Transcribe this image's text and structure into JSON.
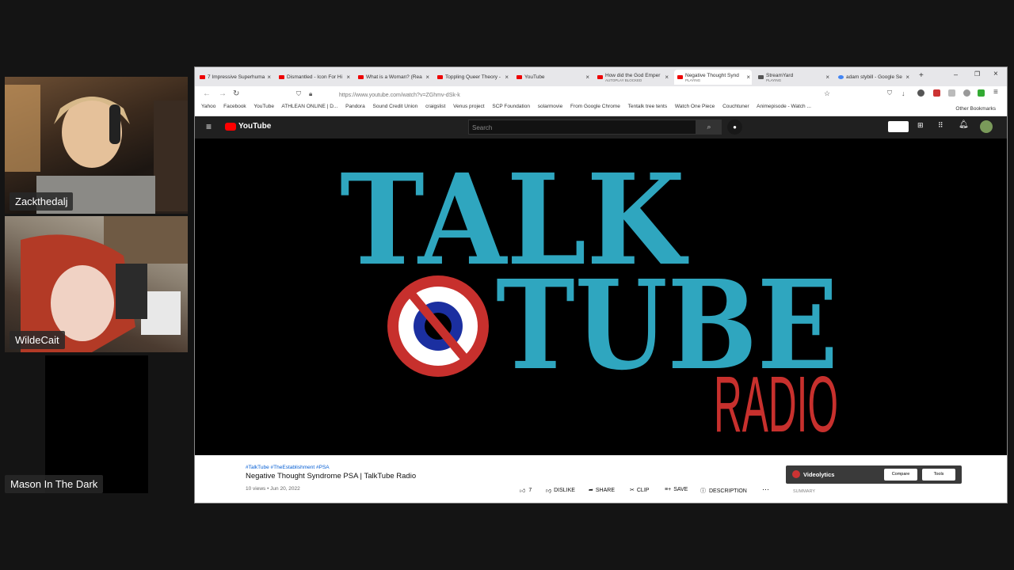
{
  "participants": [
    {
      "name": "Zackthedalj"
    },
    {
      "name": "WildeCait"
    },
    {
      "name": "Mason In The Dark"
    }
  ],
  "browser": {
    "tabs": [
      {
        "label": "7 Impressive Superhuma"
      },
      {
        "label": "Dismantled - Icon For Hi"
      },
      {
        "label": "What is a Woman? (Rea"
      },
      {
        "label": "Toppling Queer Theory -"
      },
      {
        "label": "YouTube"
      },
      {
        "label": "How did the God Emper",
        "sub": "AUTOPLAY BLOCKED"
      },
      {
        "label": "Negative Thought Synd",
        "sub": "PLAYING"
      },
      {
        "label": "StreamYard",
        "sub": "PLAYING"
      },
      {
        "label": "adam stybill - Google Se"
      }
    ],
    "url": "https://www.youtube.com/watch?v=ZGhmv-dSk-k",
    "bookmarks": [
      "Yahoo",
      "Facebook",
      "YouTube",
      "ATHLEAN ONLINE | D...",
      "Pandora",
      "Sound Credit Union",
      "craigslist",
      "Venus project",
      "SCP Foundation",
      "solarmovie",
      "From Google Chrome",
      "Tentalk tree tents",
      "Watch One Piece",
      "Couchtuner",
      "Animepisode - Watch ..."
    ],
    "other_bookmarks": "Other Bookmarks"
  },
  "youtube": {
    "logo": "YouTube",
    "search_placeholder": "Search",
    "video_art": {
      "line1": "TALK",
      "line2": "TUBE",
      "line3": "RADIO"
    },
    "hashtags": "#TalkTube #TheEstablishment #PSA",
    "title": "Negative Thought Syndrome PSA | TalkTube Radio",
    "meta": "10 views • Jun 20, 2022",
    "actions": {
      "likes": "7",
      "dislike": "DISLIKE",
      "share": "SHARE",
      "clip": "CLIP",
      "save": "SAVE",
      "description": "DESCRIPTION"
    },
    "videolytics": {
      "name": "Videolytics",
      "compare": "Compare",
      "tools": "Tools",
      "summary": "SUMMARY"
    }
  },
  "colors": {
    "logo_teal": "#2fa6bf",
    "radio_red": "#c7302d",
    "yt_red": "#ff0000"
  }
}
